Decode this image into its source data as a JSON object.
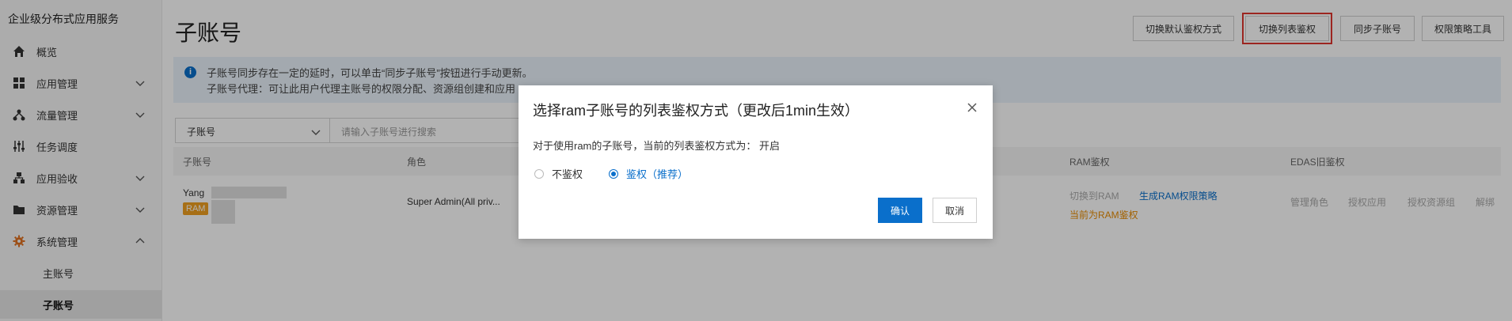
{
  "app": {
    "brand": "企业级分布式应用服务"
  },
  "sidebar": {
    "items": [
      {
        "label": "概览",
        "icon": "home-icon"
      },
      {
        "label": "应用管理",
        "icon": "grid-icon"
      },
      {
        "label": "流量管理",
        "icon": "traffic-icon"
      },
      {
        "label": "任务调度",
        "icon": "sliders-icon"
      },
      {
        "label": "应用验收",
        "icon": "tree-icon"
      },
      {
        "label": "资源管理",
        "icon": "folder-icon"
      },
      {
        "label": "系统管理",
        "icon": "gear-icon"
      }
    ],
    "subitems": [
      {
        "label": "主账号"
      },
      {
        "label": "子账号",
        "active": true
      }
    ]
  },
  "header": {
    "title": "子账号",
    "buttons": [
      {
        "label": "切换默认鉴权方式"
      },
      {
        "label": "切换列表鉴权",
        "highlighted": true
      },
      {
        "label": "同步子账号"
      },
      {
        "label": "权限策略工具"
      }
    ]
  },
  "notice": {
    "line1": "子账号同步存在一定的延时，可以单击“同步子账号”按钮进行手动更新。",
    "line2": "子账号代理：可让此用户代理主账号的权限分配、资源组创建和应用"
  },
  "filter": {
    "select_value": "子账号",
    "search_placeholder": "请输入子账号进行搜索"
  },
  "table": {
    "headers": {
      "account": "子账号",
      "role": "角色",
      "ram": "RAM鉴权",
      "edas": "EDAS旧鉴权"
    },
    "rows": [
      {
        "account": "Yang",
        "tag": "RAM",
        "role": "Super Admin(All priv...",
        "ram_switch": "切换到RAM",
        "ram_gen": "生成RAM权限策略",
        "ram_current": "当前为RAM鉴权",
        "edas_actions": [
          "管理角色",
          "授权应用",
          "授权资源组",
          "解绑"
        ]
      }
    ]
  },
  "modal": {
    "title": "选择ram子账号的列表鉴权方式（更改后1min生效）",
    "description": "对于使用ram的子账号，当前的列表鉴权方式为： 开启",
    "options": [
      {
        "label": "不鉴权",
        "selected": false
      },
      {
        "label": "鉴权（推荐）",
        "selected": true
      }
    ],
    "confirm_label": "确认",
    "cancel_label": "取消"
  },
  "colors": {
    "accent": "#0a6fcb",
    "highlight": "#e0362f",
    "warning": "#e88b00"
  }
}
